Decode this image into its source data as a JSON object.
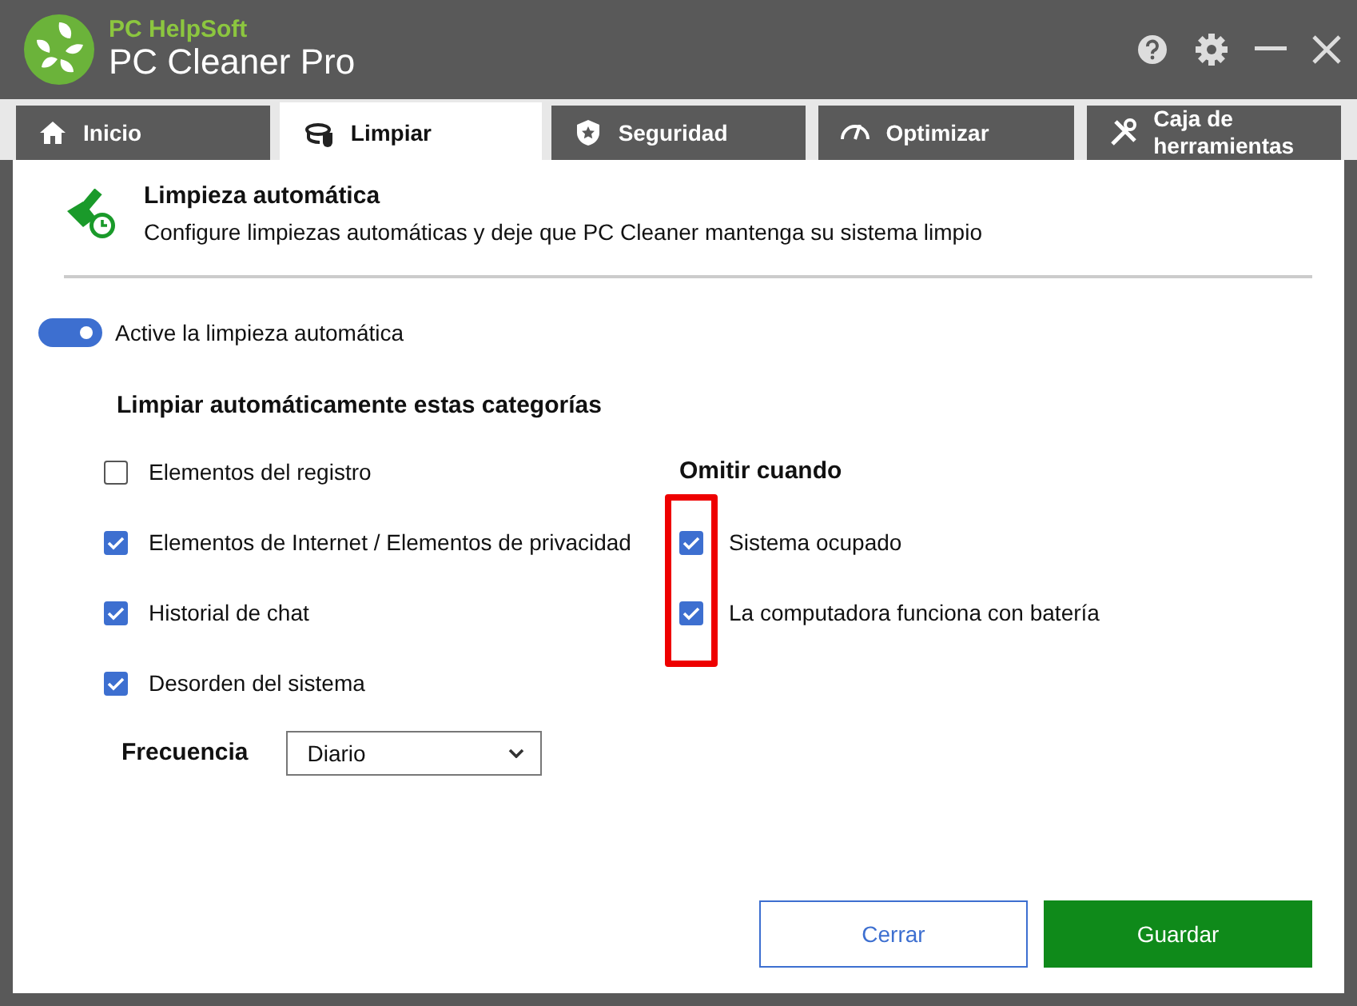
{
  "app": {
    "vendor": "PC HelpSoft",
    "title": "PC Cleaner Pro"
  },
  "tabs": [
    {
      "label": "Inicio",
      "selected": false
    },
    {
      "label": "Limpiar",
      "selected": true
    },
    {
      "label": "Seguridad",
      "selected": false
    },
    {
      "label": "Optimizar",
      "selected": false
    },
    {
      "label": "Caja de herramientas",
      "selected": false
    }
  ],
  "header": {
    "title": "Limpieza automática",
    "subtitle": "Configure limpiezas automáticas y deje que PC Cleaner mantenga su sistema limpio"
  },
  "toggle": {
    "label": "Active la limpieza automática",
    "on": true
  },
  "categories": {
    "title": "Limpiar automáticamente estas categorías",
    "items": [
      {
        "label": "Elementos del registro",
        "checked": false
      },
      {
        "label": "Elementos de Internet / Elementos de privacidad",
        "checked": true
      },
      {
        "label": "Historial de chat",
        "checked": true
      },
      {
        "label": "Desorden del sistema",
        "checked": true
      }
    ]
  },
  "skip": {
    "title": "Omitir cuando",
    "highlighted": true,
    "items": [
      {
        "label": "Sistema ocupado",
        "checked": true
      },
      {
        "label": "La computadora funciona con batería",
        "checked": true
      }
    ]
  },
  "frequency": {
    "label": "Frecuencia",
    "value": "Diario"
  },
  "buttons": [
    {
      "label": "Cerrar",
      "kind": "secondary"
    },
    {
      "label": "Guardar",
      "kind": "primary"
    }
  ]
}
